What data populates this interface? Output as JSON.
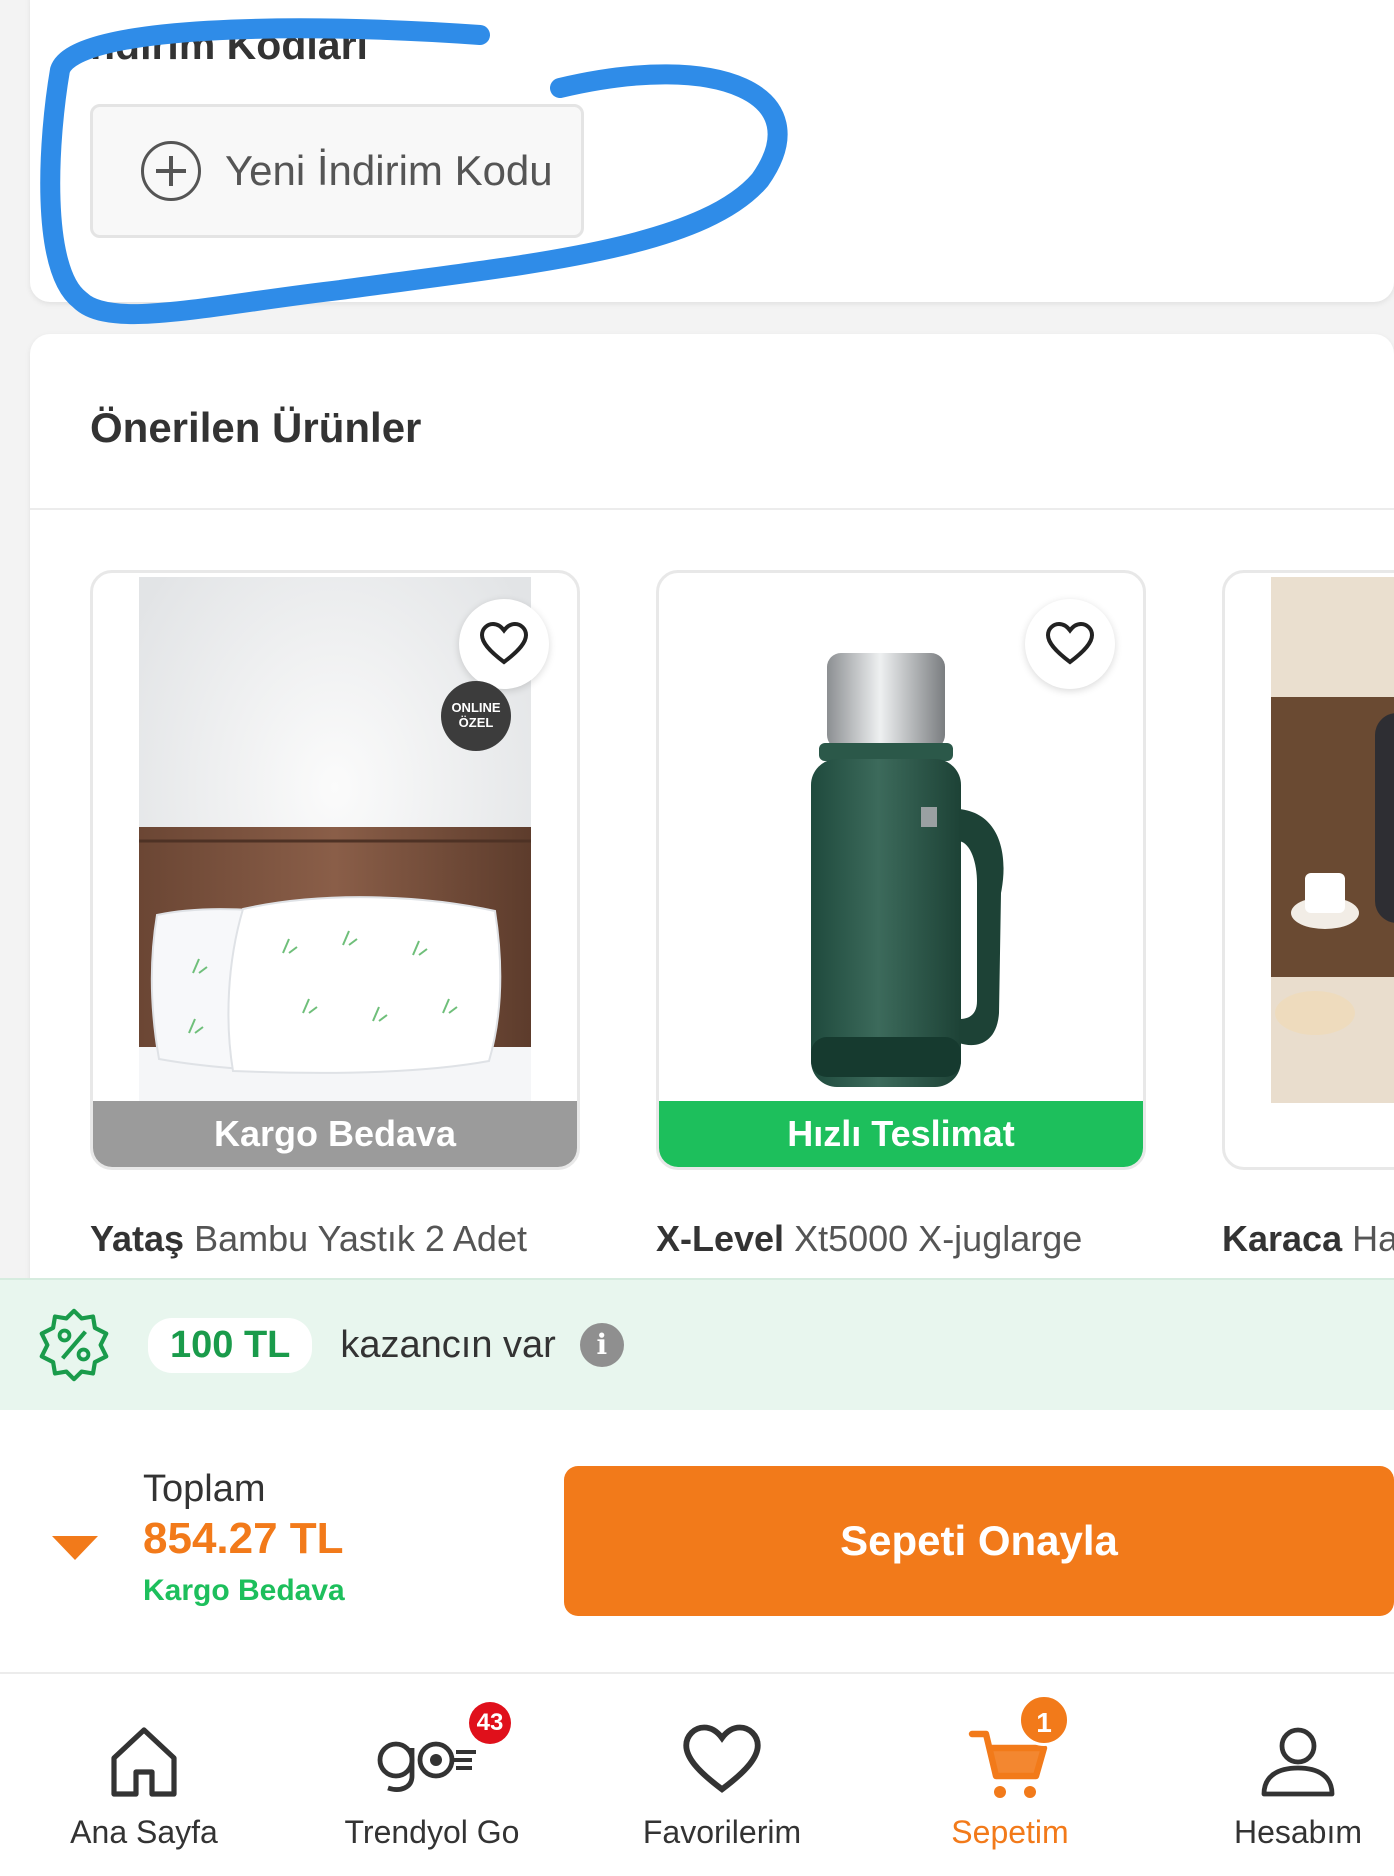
{
  "coupons": {
    "title": "ndirim Kodları",
    "new_code_label": "Yeni İndirim Kodu"
  },
  "recommended": {
    "title": "Önerilen Ürünler",
    "products": [
      {
        "brand": "Yataş",
        "name": "Bambu Yastık 2 Adet",
        "ribbon": "Kargo Bedava",
        "badge_line1": "ONLINE",
        "badge_line2": "ÖZEL"
      },
      {
        "brand": "X-Level",
        "name": "Xt5000 X-juglarge",
        "ribbon": "Hızlı Teslimat"
      },
      {
        "brand": "Karaca",
        "name": "Hat"
      }
    ]
  },
  "earnings": {
    "amount": "100 TL",
    "text": "kazancın var",
    "info": "i"
  },
  "checkout": {
    "total_label": "Toplam",
    "total_value": "854.27 TL",
    "shipping_label": "Kargo Bedava",
    "confirm_label": "Sepeti Onayla"
  },
  "nav": {
    "items": [
      {
        "label": "Ana Sayfa",
        "icon": "home-icon"
      },
      {
        "label": "Trendyol Go",
        "icon": "trendyol-go-icon",
        "badge": "43"
      },
      {
        "label": "Favorilerim",
        "icon": "heart-icon"
      },
      {
        "label": "Sepetim",
        "icon": "cart-icon",
        "badge": "1",
        "active": true
      },
      {
        "label": "Hesabım",
        "icon": "user-icon"
      }
    ]
  },
  "colors": {
    "brand_orange": "#f27a1a",
    "success_green": "#1dbf5c",
    "highlight_blue": "#2f8ce8"
  }
}
